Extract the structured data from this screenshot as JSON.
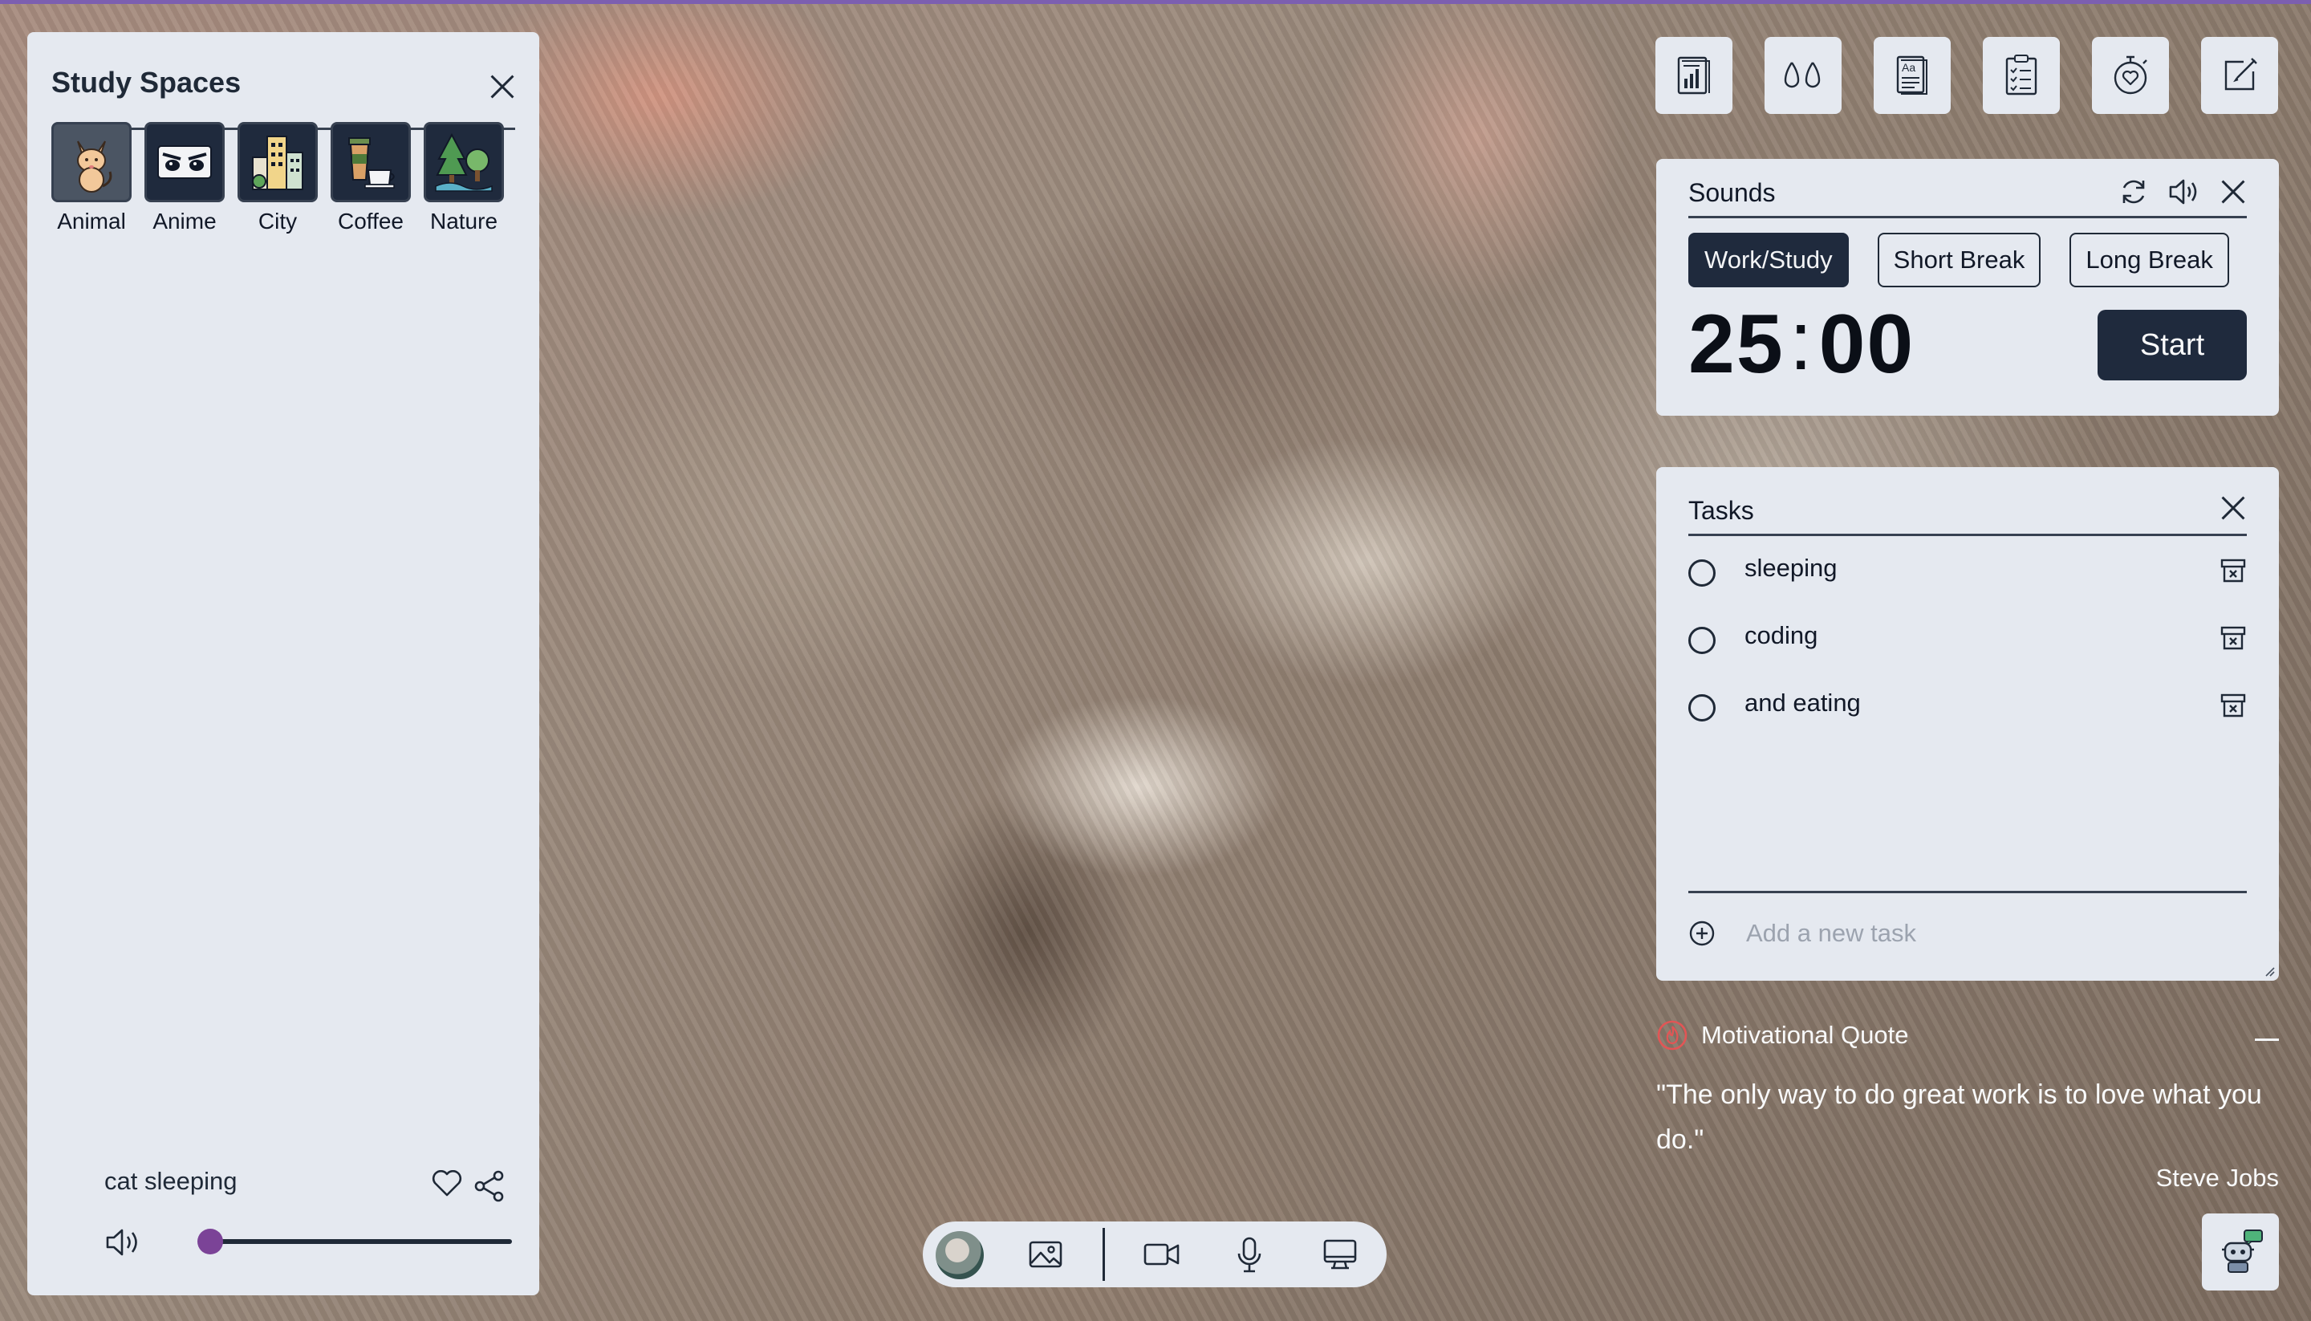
{
  "study_spaces": {
    "title": "Study Spaces",
    "categories": [
      {
        "label": "Animal",
        "icon": "cat-icon"
      },
      {
        "label": "Anime",
        "icon": "anime-eyes-icon"
      },
      {
        "label": "City",
        "icon": "city-buildings-icon"
      },
      {
        "label": "Coffee",
        "icon": "coffee-cup-icon"
      },
      {
        "label": "Nature",
        "icon": "trees-icon"
      }
    ],
    "selected": "Animal",
    "now_playing": {
      "title": "cat sleeping",
      "volume": 0
    }
  },
  "toolbar": {
    "icons": [
      "stats-report-icon",
      "ambient-sounds-icon",
      "dictionary-icon",
      "task-checklist-icon",
      "focus-timer-icon",
      "notes-edit-icon"
    ]
  },
  "timer": {
    "title": "Sounds",
    "modes": [
      "Work/Study",
      "Short Break",
      "Long Break"
    ],
    "active_mode": "Work/Study",
    "minutes": "25",
    "seconds": "00",
    "start_label": "Start"
  },
  "tasks": {
    "title": "Tasks",
    "items": [
      {
        "text": "sleeping",
        "done": false
      },
      {
        "text": "coding",
        "done": false
      },
      {
        "text": "and eating",
        "done": false
      }
    ],
    "add_placeholder": "Add a new task"
  },
  "quote": {
    "title": "Motivational Quote",
    "text": "\"The only way to do great work is to love what you do.\"",
    "author": "Steve Jobs"
  },
  "colors": {
    "panel": "#e5e9f0",
    "dark": "#1f2a3d",
    "accent": "#7b4397",
    "top_bar": "#7c5fb0"
  }
}
